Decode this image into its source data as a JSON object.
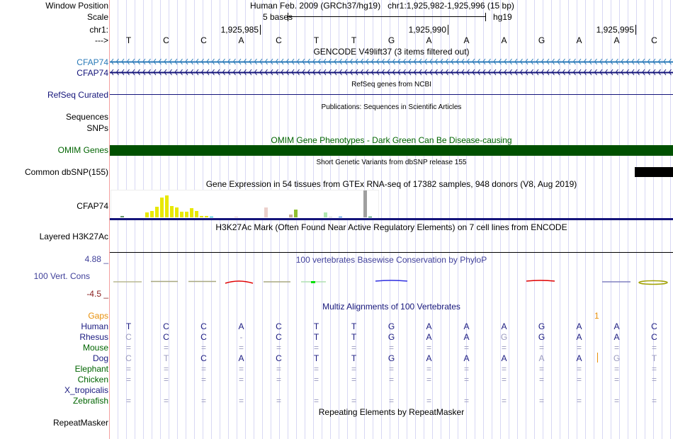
{
  "header": {
    "window_position_label": "Window Position",
    "position_text": "Human Feb. 2009 (GRCh37/hg19)   chr1:1,925,982-1,925,996 (15 bp)",
    "scale_label": "Scale",
    "scale_text": "5 bases",
    "assembly": "hg19",
    "chrom_label": "chr1:",
    "coords": [
      "1,925,985",
      "1,925,990",
      "1,925,995"
    ],
    "strand_label": "--->"
  },
  "bases": [
    "T",
    "C",
    "C",
    "A",
    "C",
    "T",
    "T",
    "G",
    "A",
    "A",
    "A",
    "G",
    "A",
    "A",
    "C"
  ],
  "tracks": {
    "gencode_title": "GENCODE V49lift37 (3 items filtered out)",
    "gencode_items": [
      "CFAP74",
      "CFAP74"
    ],
    "refseq_title": "RefSeq genes from NCBI",
    "refseq_label": "RefSeq Curated",
    "pubs_title": "Publications: Sequences in Scientific Articles",
    "pubs_label": "Sequences",
    "snps_label": "SNPs",
    "omim_title": "OMIM Gene Phenotypes - Dark Green Can Be Disease-causing",
    "omim_label": "OMIM Genes",
    "dbsnp_title": "Short Genetic Variants from dbSNP release 155",
    "dbsnp_label": "Common dbSNP(155)",
    "gtex_title": "Gene Expression in 54 tissues from GTEx RNA-seq of 17382 samples, 948 donors (V8, Aug 2019)",
    "gtex_label": "CFAP74",
    "h3k_title": "H3K27Ac Mark (Often Found Near Active Regulatory Elements) on 7 cell lines from ENCODE",
    "h3k_label": "Layered H3K27Ac",
    "cons_title": "100 vertebrates Basewise Conservation by PhyloP",
    "cons_label": "100 Vert. Cons",
    "cons_max": "4.88 _",
    "cons_min": "-4.5 _",
    "multiz_title": "Multiz Alignments of 100 Vertebrates",
    "gaps_label": "Gaps",
    "gap_count": "1",
    "rmsk_title": "Repeating Elements by RepeatMasker",
    "rmsk_label": "RepeatMasker"
  },
  "colors": {
    "gencode1": "#2a7ab8",
    "gencode2": "#14147a",
    "omim": "#005000",
    "navy": "#1a1a80",
    "mismatch": "#9a9ac0",
    "green": "#006400",
    "gap": "#e8900a"
  },
  "gtex_values": [
    {
      "v": 2,
      "c": "#6a9a6a"
    },
    {
      "v": 0,
      "c": "#ccc"
    },
    {
      "v": 0,
      "c": "#ccc"
    },
    {
      "v": 0,
      "c": "#ccc"
    },
    {
      "v": 0,
      "c": "#ccc"
    },
    {
      "v": 7,
      "c": "#e8e800"
    },
    {
      "v": 9,
      "c": "#e8e800"
    },
    {
      "v": 15,
      "c": "#e8e800"
    },
    {
      "v": 28,
      "c": "#e8e800"
    },
    {
      "v": 31,
      "c": "#e8e800"
    },
    {
      "v": 16,
      "c": "#e8e800"
    },
    {
      "v": 14,
      "c": "#e8e800"
    },
    {
      "v": 8,
      "c": "#e8e800"
    },
    {
      "v": 8,
      "c": "#e8e800"
    },
    {
      "v": 13,
      "c": "#e8e800"
    },
    {
      "v": 9,
      "c": "#e8e800"
    },
    {
      "v": 2,
      "c": "#e8e800"
    },
    {
      "v": 2,
      "c": "#e8e800"
    },
    {
      "v": 1,
      "c": "#00c0d0"
    },
    {
      "v": 0,
      "c": "#ccc"
    },
    {
      "v": 0,
      "c": "#ccc"
    },
    {
      "v": 0,
      "c": "#ccc"
    },
    {
      "v": 0,
      "c": "#ccc"
    },
    {
      "v": 1,
      "c": "#f0d0d0"
    },
    {
      "v": 0,
      "c": "#ccc"
    },
    {
      "v": 0,
      "c": "#ccc"
    },
    {
      "v": 0,
      "c": "#ccc"
    },
    {
      "v": 0,
      "c": "#ccc"
    },
    {
      "v": 0,
      "c": "#ccc"
    },
    {
      "v": 14,
      "c": "#ecd0cc"
    },
    {
      "v": 0,
      "c": "#ccc"
    },
    {
      "v": 0,
      "c": "#ccc"
    },
    {
      "v": 0,
      "c": "#ccc"
    },
    {
      "v": 0,
      "c": "#ccc"
    },
    {
      "v": 4,
      "c": "#c8b098"
    },
    {
      "v": 11,
      "c": "#90c030"
    },
    {
      "v": 0,
      "c": "#ccc"
    },
    {
      "v": 0,
      "c": "#ccc"
    },
    {
      "v": 0,
      "c": "#ccc"
    },
    {
      "v": 0,
      "c": "#ccc"
    },
    {
      "v": 0,
      "c": "#ccc"
    },
    {
      "v": 7,
      "c": "#b0e8b0"
    },
    {
      "v": 1,
      "c": "#d8d8d8"
    },
    {
      "v": 0,
      "c": "#ccc"
    },
    {
      "v": 1,
      "c": "#2080e0"
    },
    {
      "v": 0,
      "c": "#ccc"
    },
    {
      "v": 0,
      "c": "#ccc"
    },
    {
      "v": 0,
      "c": "#ccc"
    },
    {
      "v": 0,
      "c": "#ccc"
    },
    {
      "v": 38,
      "c": "#a0a0a0"
    },
    {
      "v": 1,
      "c": "#108040"
    }
  ],
  "species": [
    {
      "name": "Human",
      "color": "#1a1a80",
      "seq": [
        "T",
        "C",
        "C",
        "A",
        "C",
        "T",
        "T",
        "G",
        "A",
        "A",
        "A",
        "G",
        "A",
        "A",
        "C"
      ],
      "mm": []
    },
    {
      "name": "Rhesus",
      "color": "#1a1a80",
      "seq": [
        "C",
        "C",
        "C",
        "-",
        "C",
        "T",
        "T",
        "G",
        "A",
        "A",
        "G",
        "G",
        "A",
        "A",
        "C"
      ],
      "mm": [
        0,
        3,
        10
      ]
    },
    {
      "name": "Mouse",
      "color": "#006400",
      "seq": [
        "=",
        "=",
        "=",
        "=",
        "=",
        "=",
        "=",
        "=",
        "=",
        "=",
        "=",
        "=",
        "=",
        "=",
        "="
      ],
      "mm": [
        0,
        1,
        2,
        3,
        4,
        5,
        6,
        7,
        8,
        9,
        10,
        11,
        12,
        13,
        14
      ]
    },
    {
      "name": "Dog",
      "color": "#1a1a80",
      "seq": [
        "C",
        "T",
        "C",
        "A",
        "C",
        "T",
        "T",
        "G",
        "A",
        "A",
        "A",
        "A",
        "A",
        "G",
        "T"
      ],
      "mm": [
        0,
        1,
        11,
        13,
        14
      ]
    },
    {
      "name": "Elephant",
      "color": "#006400",
      "seq": [
        "=",
        "=",
        "=",
        "=",
        "=",
        "=",
        "=",
        "=",
        "=",
        "=",
        "=",
        "=",
        "=",
        "=",
        "="
      ],
      "mm": [
        0,
        1,
        2,
        3,
        4,
        5,
        6,
        7,
        8,
        9,
        10,
        11,
        12,
        13,
        14
      ]
    },
    {
      "name": "Chicken",
      "color": "#006400",
      "seq": [
        "=",
        "=",
        "=",
        "=",
        "=",
        "=",
        "=",
        "=",
        "=",
        "=",
        "=",
        "=",
        "=",
        "=",
        "="
      ],
      "mm": [
        0,
        1,
        2,
        3,
        4,
        5,
        6,
        7,
        8,
        9,
        10,
        11,
        12,
        13,
        14
      ]
    },
    {
      "name": "X_tropicalis",
      "color": "#1a1a80",
      "seq": [],
      "mm": []
    },
    {
      "name": "Zebrafish",
      "color": "#006400",
      "seq": [
        "=",
        "=",
        "=",
        "=",
        "=",
        "=",
        "=",
        "=",
        "=",
        "=",
        "=",
        "=",
        "=",
        "=",
        "="
      ],
      "mm": [
        0,
        1,
        2,
        3,
        4,
        5,
        6,
        7,
        8,
        9,
        10,
        11,
        12,
        13,
        14
      ]
    }
  ]
}
